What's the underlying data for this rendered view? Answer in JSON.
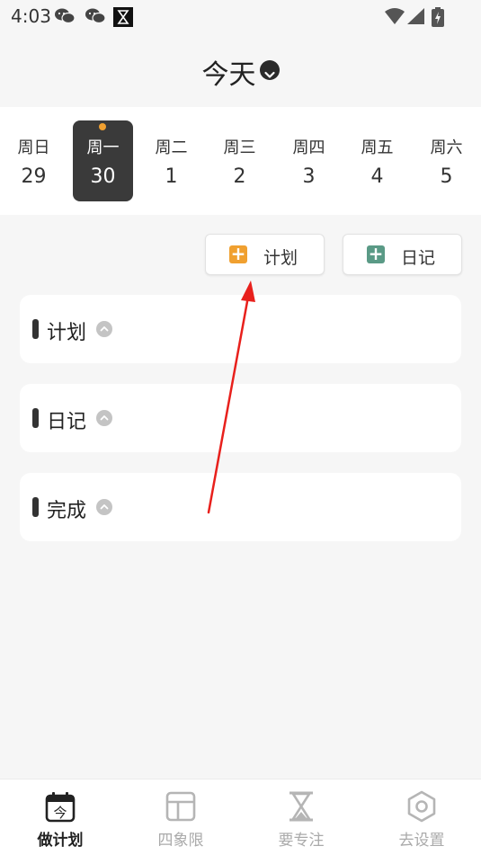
{
  "status_bar": {
    "time": "4:03",
    "icons": [
      "wechat-icon",
      "wechat-icon",
      "hourglass-app-icon",
      "wifi-icon",
      "signal-icon",
      "battery-charging-icon"
    ]
  },
  "header": {
    "title": "今天",
    "dropdown_icon": "chevron-down-icon"
  },
  "week": {
    "days": [
      {
        "name": "周日",
        "num": "29"
      },
      {
        "name": "周一",
        "num": "30",
        "selected": true,
        "has_dot": true
      },
      {
        "name": "周二",
        "num": "1"
      },
      {
        "name": "周三",
        "num": "2"
      },
      {
        "name": "周四",
        "num": "3"
      },
      {
        "name": "周五",
        "num": "4"
      },
      {
        "name": "周六",
        "num": "5"
      }
    ],
    "selected_color": "#3a3a3a",
    "dot_color": "#f0a030"
  },
  "actions": {
    "plan": {
      "label": "计划",
      "icon": "plus-icon",
      "color": "#f0a030"
    },
    "diary": {
      "label": "日记",
      "icon": "plus-icon",
      "color": "#5a9a86"
    }
  },
  "sections": [
    {
      "title": "计划",
      "icon": "chevron-up-icon"
    },
    {
      "title": "日记",
      "icon": "chevron-up-icon"
    },
    {
      "title": "完成",
      "icon": "chevron-up-icon"
    }
  ],
  "annotation": {
    "color": "#e8201c"
  },
  "tabbar": {
    "tabs": [
      {
        "label": "做计划",
        "icon": "calendar-today-icon",
        "icon_text": "今",
        "active": true
      },
      {
        "label": "四象限",
        "icon": "quadrant-layout-icon"
      },
      {
        "label": "要专注",
        "icon": "hourglass-icon"
      },
      {
        "label": "去设置",
        "icon": "settings-hexagon-icon"
      }
    ],
    "active_color": "#222222",
    "inactive_color": "#aaaaaa"
  }
}
